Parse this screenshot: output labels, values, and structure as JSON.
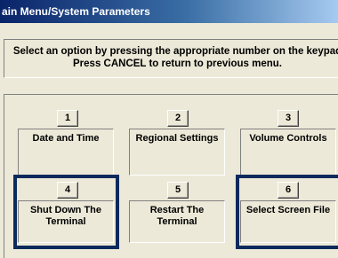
{
  "window": {
    "title": "ain Menu/System Parameters"
  },
  "instructions": {
    "line1": "Select an option by pressing the appropriate number on the keypad",
    "line2": "Press CANCEL to return to previous menu."
  },
  "options": [
    {
      "number": "1",
      "label": "Date and Time",
      "highlighted": false
    },
    {
      "number": "2",
      "label": "Regional Settings",
      "highlighted": false
    },
    {
      "number": "3",
      "label": "Volume Controls",
      "highlighted": false
    },
    {
      "number": "4",
      "label": "Shut Down The\nTerminal",
      "label_line1": "Shut Down The",
      "label_line2": "Terminal",
      "highlighted": true
    },
    {
      "number": "5",
      "label": "Restart The\nTerminal",
      "label_line1": "Restart The",
      "label_line2": "Terminal",
      "highlighted": false
    },
    {
      "number": "6",
      "label": "Select Screen File",
      "highlighted": true
    }
  ],
  "colors": {
    "highlight_border": "#0c2a5c",
    "background": "#ece9d8",
    "titlebar": "#0a246a"
  }
}
